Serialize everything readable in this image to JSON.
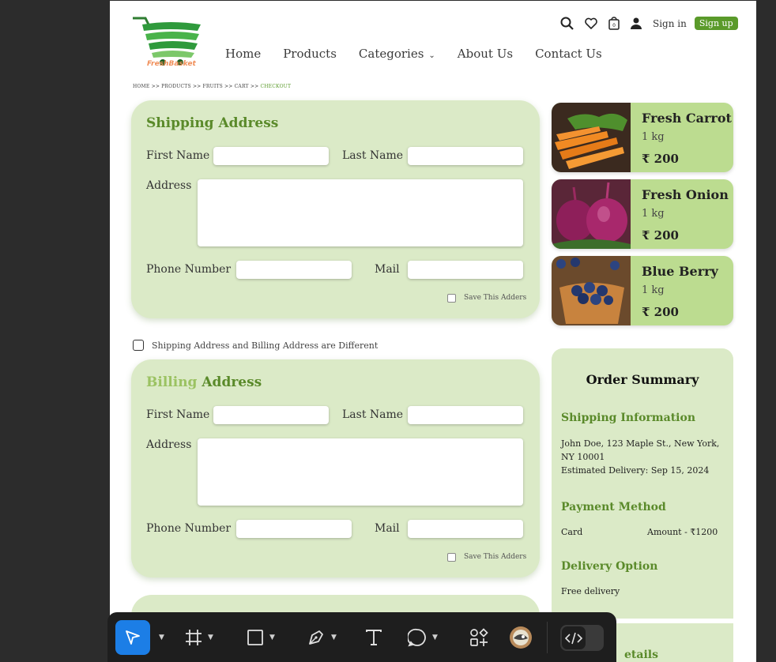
{
  "brand": {
    "name": "FreshBasket",
    "accent": "#5a9a2a"
  },
  "nav": {
    "items": [
      "Home",
      "Products",
      "Categories",
      "About Us",
      "Contact Us"
    ]
  },
  "top_actions": {
    "signin": "Sign in",
    "signup": "Sign up"
  },
  "breadcrumb": {
    "home": "HOME",
    "products": "PRODUCTS",
    "fruits": "FRUITS",
    "cart": "CART",
    "checkout": "CHECKOUT",
    "sep": ">>"
  },
  "shipping": {
    "title": "Shipping Address",
    "first_name": "First Name",
    "last_name": "Last Name",
    "address": "Address",
    "phone": "Phone Number",
    "mail": "Mail",
    "save": "Save This Adders"
  },
  "different_label": "Shipping Address and Billing Address are Different",
  "billing": {
    "title_a": "Billing",
    "title_b": " Address",
    "first_name": "First Name",
    "last_name": "Last Name",
    "address": "Address",
    "phone": "Phone Number",
    "mail": "Mail",
    "save": "Save This Adders"
  },
  "products": [
    {
      "name": "Fresh Carrot",
      "qty": "1 kg",
      "price": "₹ 200"
    },
    {
      "name": "Fresh Onion",
      "qty": "1 kg",
      "price": "₹ 200"
    },
    {
      "name": "Blue Berry",
      "qty": "1 kg",
      "price": "₹ 200"
    }
  ],
  "summary": {
    "title": "Order Summary",
    "shipping_title": "Shipping Information",
    "address_line1": "John Doe, 123 Maple St., New York,",
    "address_line2": "NY 10001",
    "delivery_estimate": "Estimated Delivery: Sep 15, 2024",
    "payment_title": "Payment Method",
    "payment_method": "Card",
    "amount": "Amount - ₹1200",
    "delivery_title": "Delivery Option",
    "delivery_option": "Free delivery",
    "details_partial": "etails"
  },
  "toolbar": {
    "tools": [
      "move-tool",
      "frame-tool",
      "shape-tool",
      "pen-tool",
      "text-tool",
      "comment-tool",
      "actions-tool",
      "plugin-tool",
      "dev-mode-toggle"
    ]
  }
}
